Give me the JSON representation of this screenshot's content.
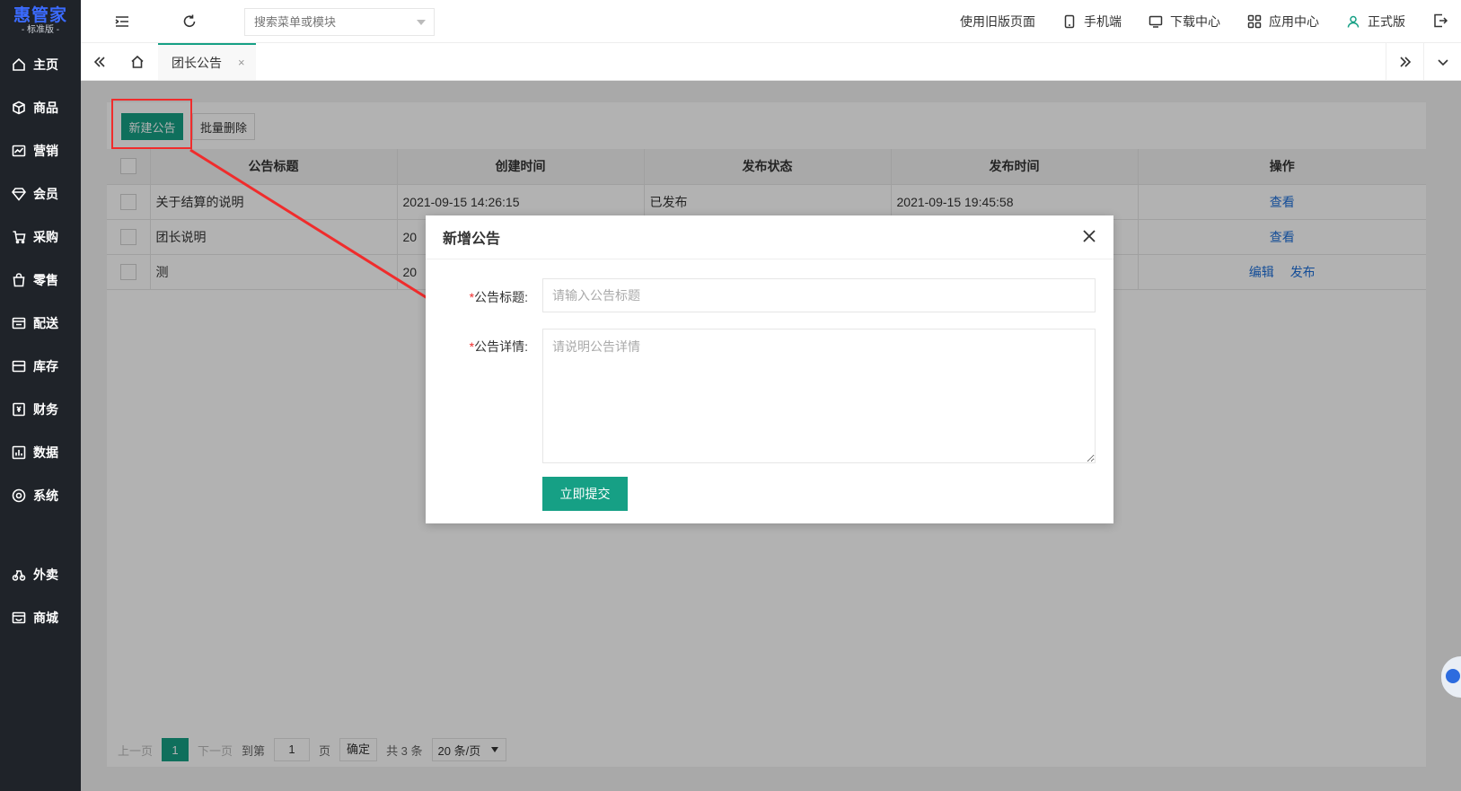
{
  "app": {
    "logo_main": "惠管家",
    "logo_sub": "- 标准版 -"
  },
  "sidebar": {
    "items": [
      {
        "label": "主页",
        "icon": "home-icon"
      },
      {
        "label": "商品",
        "icon": "box-icon"
      },
      {
        "label": "营销",
        "icon": "chart-line-icon"
      },
      {
        "label": "会员",
        "icon": "diamond-icon"
      },
      {
        "label": "采购",
        "icon": "purchase-icon"
      },
      {
        "label": "零售",
        "icon": "bag-icon"
      },
      {
        "label": "配送",
        "icon": "delivery-icon"
      },
      {
        "label": "库存",
        "icon": "inventory-icon"
      },
      {
        "label": "财务",
        "icon": "finance-icon"
      },
      {
        "label": "数据",
        "icon": "bar-chart-icon"
      },
      {
        "label": "系统",
        "icon": "settings-icon"
      },
      {
        "label": "外卖",
        "icon": "takeaway-icon"
      },
      {
        "label": "商城",
        "icon": "store-icon"
      }
    ]
  },
  "header": {
    "search_placeholder": "搜索菜单或模块",
    "old_page": "使用旧版页面",
    "mobile": "手机端",
    "download": "下载中心",
    "apps": "应用中心",
    "version": "正式版"
  },
  "tabs": {
    "active_label": "团长公告",
    "close": "×"
  },
  "toolbar": {
    "new_label": "新建公告",
    "batch_delete_label": "批量删除"
  },
  "table": {
    "headers": [
      "公告标题",
      "创建时间",
      "发布状态",
      "发布时间",
      "操作"
    ],
    "rows": [
      {
        "title": "关于结算的说明",
        "created": "2021-09-15 14:26:15",
        "status": "已发布",
        "published": "2021-09-15 19:45:58",
        "actions": [
          "查看"
        ]
      },
      {
        "title": "团长说明",
        "created": "20",
        "status": "",
        "published": "",
        "actions": [
          "查看"
        ]
      },
      {
        "title": "测",
        "created": "20",
        "status": "",
        "published": "",
        "actions": [
          "编辑",
          "发布"
        ]
      }
    ]
  },
  "pager": {
    "prev": "上一页",
    "current": "1",
    "next": "下一页",
    "goto": "到第",
    "goto_value": "1",
    "page_unit": "页",
    "confirm": "确定",
    "total": "共 3 条",
    "page_size": "20 条/页"
  },
  "modal": {
    "title": "新增公告",
    "required_mark": "*",
    "title_label": "公告标题:",
    "title_placeholder": "请输入公告标题",
    "detail_label": "公告详情:",
    "detail_placeholder": "请说明公告详情",
    "submit": "立即提交"
  },
  "colors": {
    "sidebar_bg": "#1f2329",
    "primary": "#16a085",
    "link": "#1e6fd9",
    "highlight": "#f02c2c"
  }
}
